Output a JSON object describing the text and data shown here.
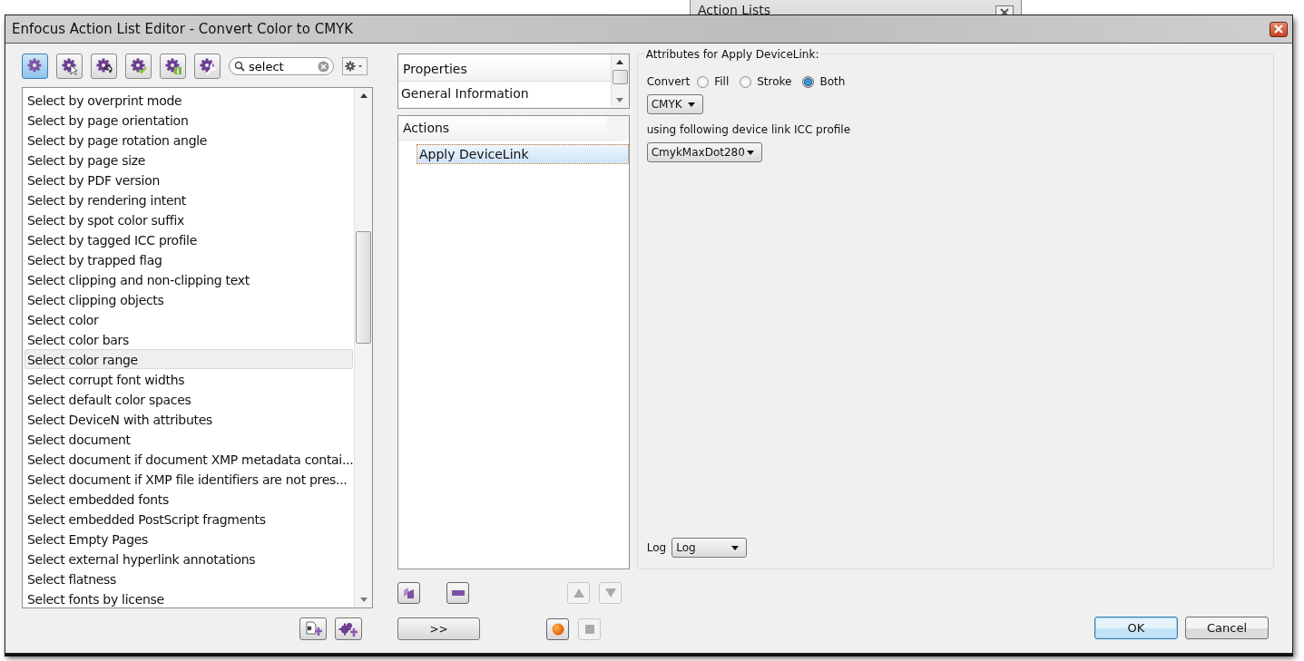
{
  "background_window": {
    "title": "Action Lists"
  },
  "window": {
    "title": "Enfocus Action List Editor - Convert Color to CMYK"
  },
  "toolbar": {
    "buttons": [
      {
        "kind": "gear",
        "selected": true
      },
      {
        "kind": "cursor",
        "selected": false
      },
      {
        "kind": "refresh",
        "selected": false
      },
      {
        "kind": "check",
        "selected": false
      },
      {
        "kind": "info",
        "selected": false
      },
      {
        "kind": "wrench",
        "selected": false
      }
    ],
    "search": {
      "value": "select"
    }
  },
  "library": {
    "items": [
      {
        "label": "Select by overprint mode",
        "selected": false
      },
      {
        "label": "Select by page orientation",
        "selected": false
      },
      {
        "label": "Select by page rotation angle",
        "selected": false
      },
      {
        "label": "Select by page size",
        "selected": false
      },
      {
        "label": "Select by PDF version",
        "selected": false
      },
      {
        "label": "Select by rendering intent",
        "selected": false
      },
      {
        "label": "Select by spot color suffix",
        "selected": false
      },
      {
        "label": "Select by tagged ICC profile",
        "selected": false
      },
      {
        "label": "Select by trapped flag",
        "selected": false
      },
      {
        "label": "Select clipping and non-clipping text",
        "selected": false
      },
      {
        "label": "Select clipping objects",
        "selected": false
      },
      {
        "label": "Select color",
        "selected": false
      },
      {
        "label": "Select color bars",
        "selected": false
      },
      {
        "label": "Select color range",
        "selected": true
      },
      {
        "label": "Select corrupt font widths",
        "selected": false
      },
      {
        "label": "Select default color spaces",
        "selected": false
      },
      {
        "label": "Select DeviceN with attributes",
        "selected": false
      },
      {
        "label": "Select document",
        "selected": false
      },
      {
        "label": "Select document if document XMP metadata contai...",
        "selected": false
      },
      {
        "label": "Select document if XMP file identifiers are not pres...",
        "selected": false
      },
      {
        "label": "Select embedded fonts",
        "selected": false
      },
      {
        "label": "Select embedded PostScript fragments",
        "selected": false
      },
      {
        "label": "Select Empty Pages",
        "selected": false
      },
      {
        "label": "Select external hyperlink annotations",
        "selected": false
      },
      {
        "label": "Select flatness",
        "selected": false
      },
      {
        "label": "Select fonts by license",
        "selected": false
      }
    ]
  },
  "properties": {
    "header": "Properties",
    "items": [
      {
        "label": "General Information",
        "selected": false
      }
    ]
  },
  "actions": {
    "header": "Actions",
    "items": [
      {
        "label": "Apply DeviceLink",
        "selected": true
      }
    ]
  },
  "add_button": ">>",
  "attributes": {
    "title": "Attributes for Apply DeviceLink:",
    "convert_label": "Convert",
    "options": [
      {
        "label": "Fill",
        "selected": false
      },
      {
        "label": "Stroke",
        "selected": false
      },
      {
        "label": "Both",
        "selected": true
      }
    ],
    "colorspace": "CMYK",
    "profile_label": "using following device link ICC profile",
    "profile": "CmykMaxDot280",
    "log_label": "Log",
    "log": "Log"
  },
  "buttons": [
    {
      "label": "OK",
      "default": true
    },
    {
      "label": "Cancel",
      "default": false
    }
  ]
}
